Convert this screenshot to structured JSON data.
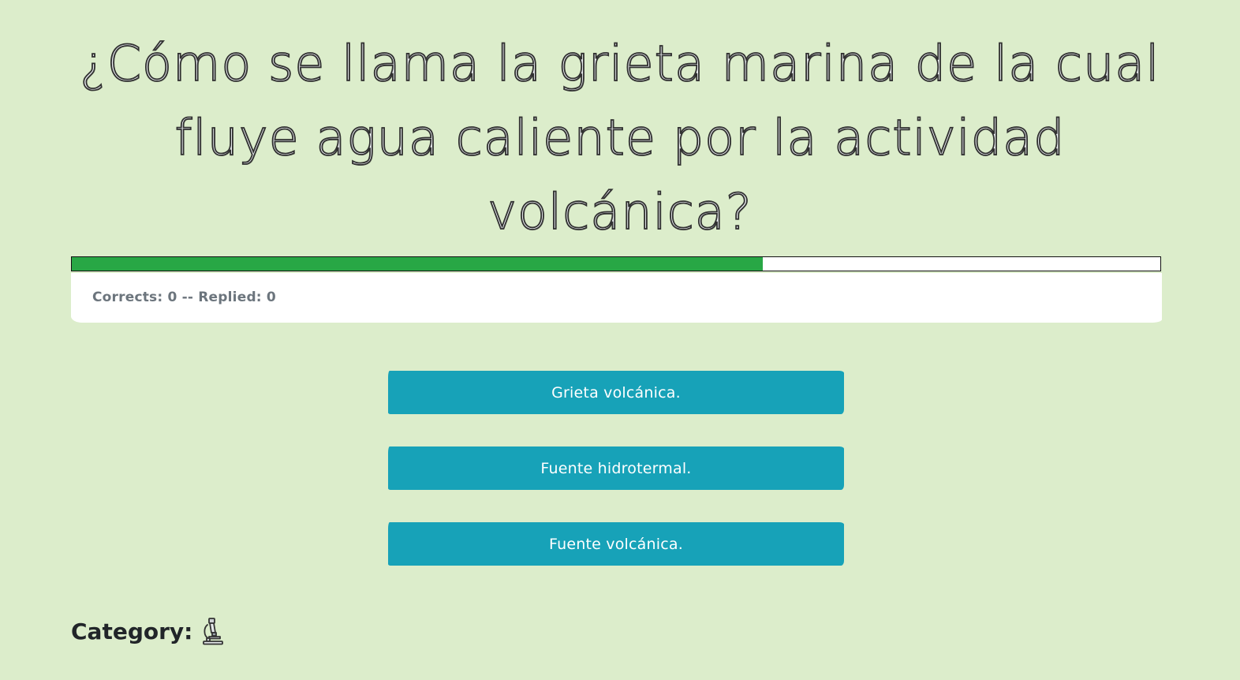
{
  "question": {
    "text": "¿Cómo se llama la grieta marina de la cual fluye agua caliente por la actividad volcánica?"
  },
  "progress": {
    "fraction": 0.635,
    "fill_color": "#28a745",
    "track_color": "#ffffff"
  },
  "score": {
    "text": "Corrects: 0 -- Replied: 0"
  },
  "answers": [
    {
      "label": "Grieta volcánica."
    },
    {
      "label": "Fuente hidrotermal."
    },
    {
      "label": "Fuente volcánica."
    }
  ],
  "category": {
    "label": "Category:",
    "icon": "microscope-icon"
  },
  "colors": {
    "background": "#dcedcb",
    "answer_button": "#17a2b8",
    "score_text": "#6c757d"
  }
}
